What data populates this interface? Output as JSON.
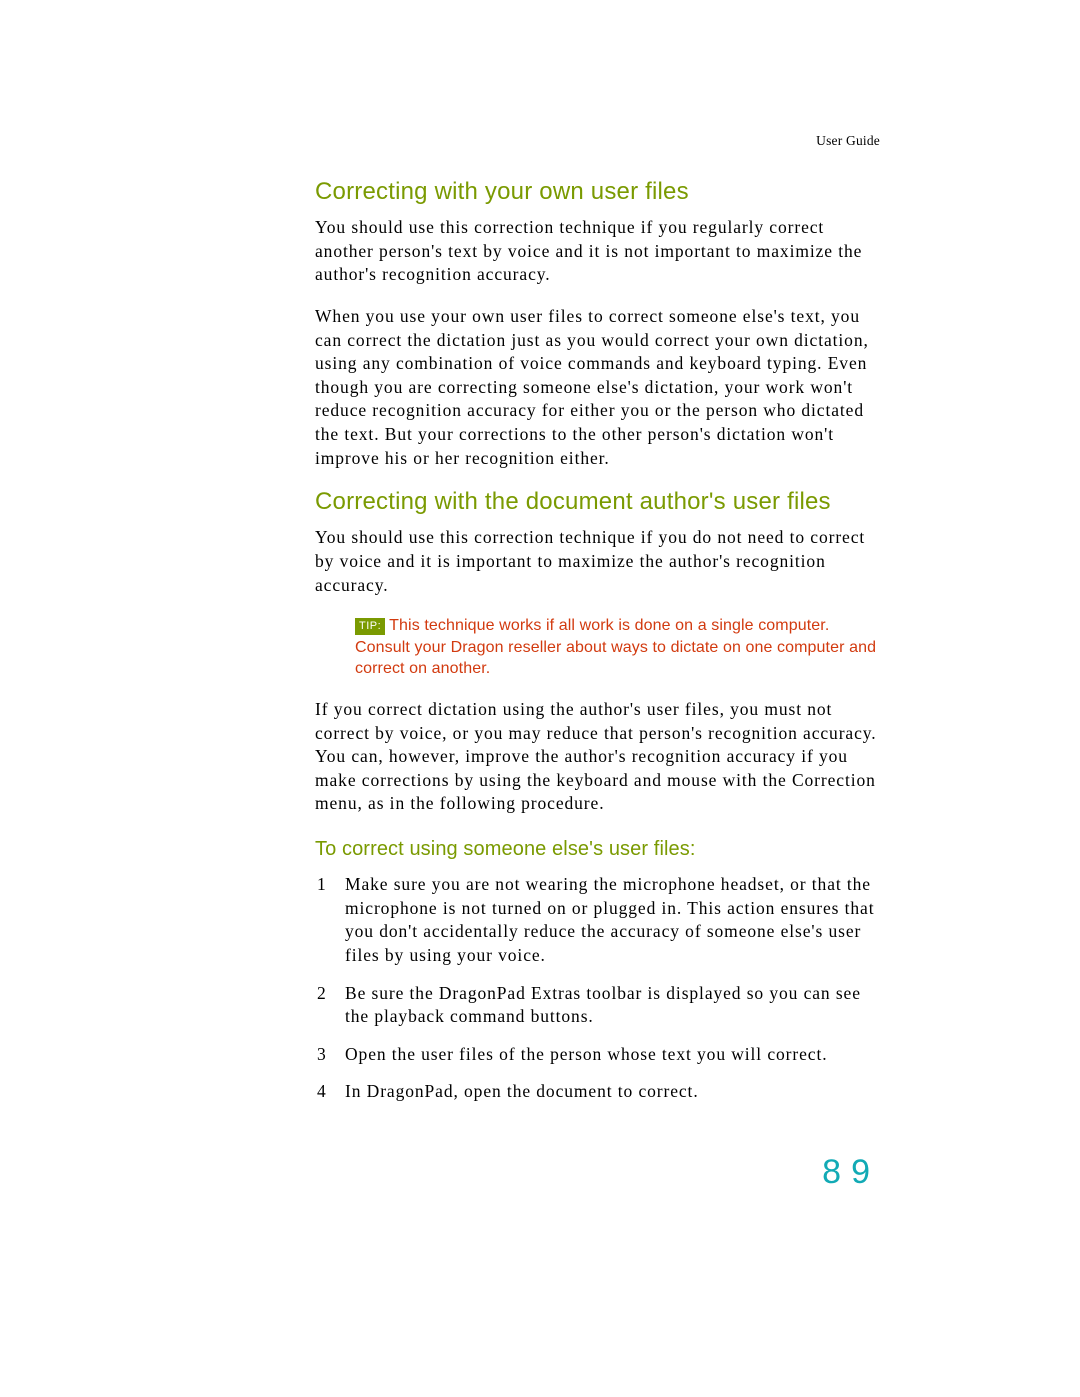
{
  "running_header": "User Guide",
  "page_number": "89",
  "section1": {
    "heading": "Correcting with your own user files",
    "p1": "You should use this correction technique if you regularly correct another person's text by voice and it is not important to maximize the author's recognition accuracy.",
    "p2": "When you use your own user files to correct someone else's text, you can correct the dictation just as you would correct your own dictation, using any combination of voice commands and keyboard typing. Even though you are correcting someone else's dictation, your work won't reduce recognition accuracy for either you or the person who dictated the text. But your corrections to the other person's dictation won't improve his or her recognition either."
  },
  "section2": {
    "heading": "Correcting with the document author's user files",
    "p1": "You should use this correction technique if you do not need to correct by voice and it is important to maximize the author's recognition accuracy.",
    "tip_label": "TIP:",
    "tip_text": "This technique works if all work is done on a single computer. Consult your Dragon reseller about ways to dictate on one computer and correct on another.",
    "p2": "If you correct dictation using the author's user files, you must not correct by voice, or you may reduce that person's recognition accuracy. You can, however, improve the author's recognition accuracy if you make corrections by using the keyboard and mouse with the Correction menu, as in the following procedure.",
    "subheading": "To correct using someone else's user files:",
    "steps": [
      "Make sure you are not wearing the microphone headset, or that the microphone is not turned on or plugged in. This action ensures that you don't accidentally reduce the accuracy of someone else's user files by using your voice.",
      "Be sure the DragonPad Extras toolbar is displayed so you can see the playback command buttons.",
      "Open the user files of the person whose text you will correct.",
      "In DragonPad, open the document to correct."
    ]
  }
}
